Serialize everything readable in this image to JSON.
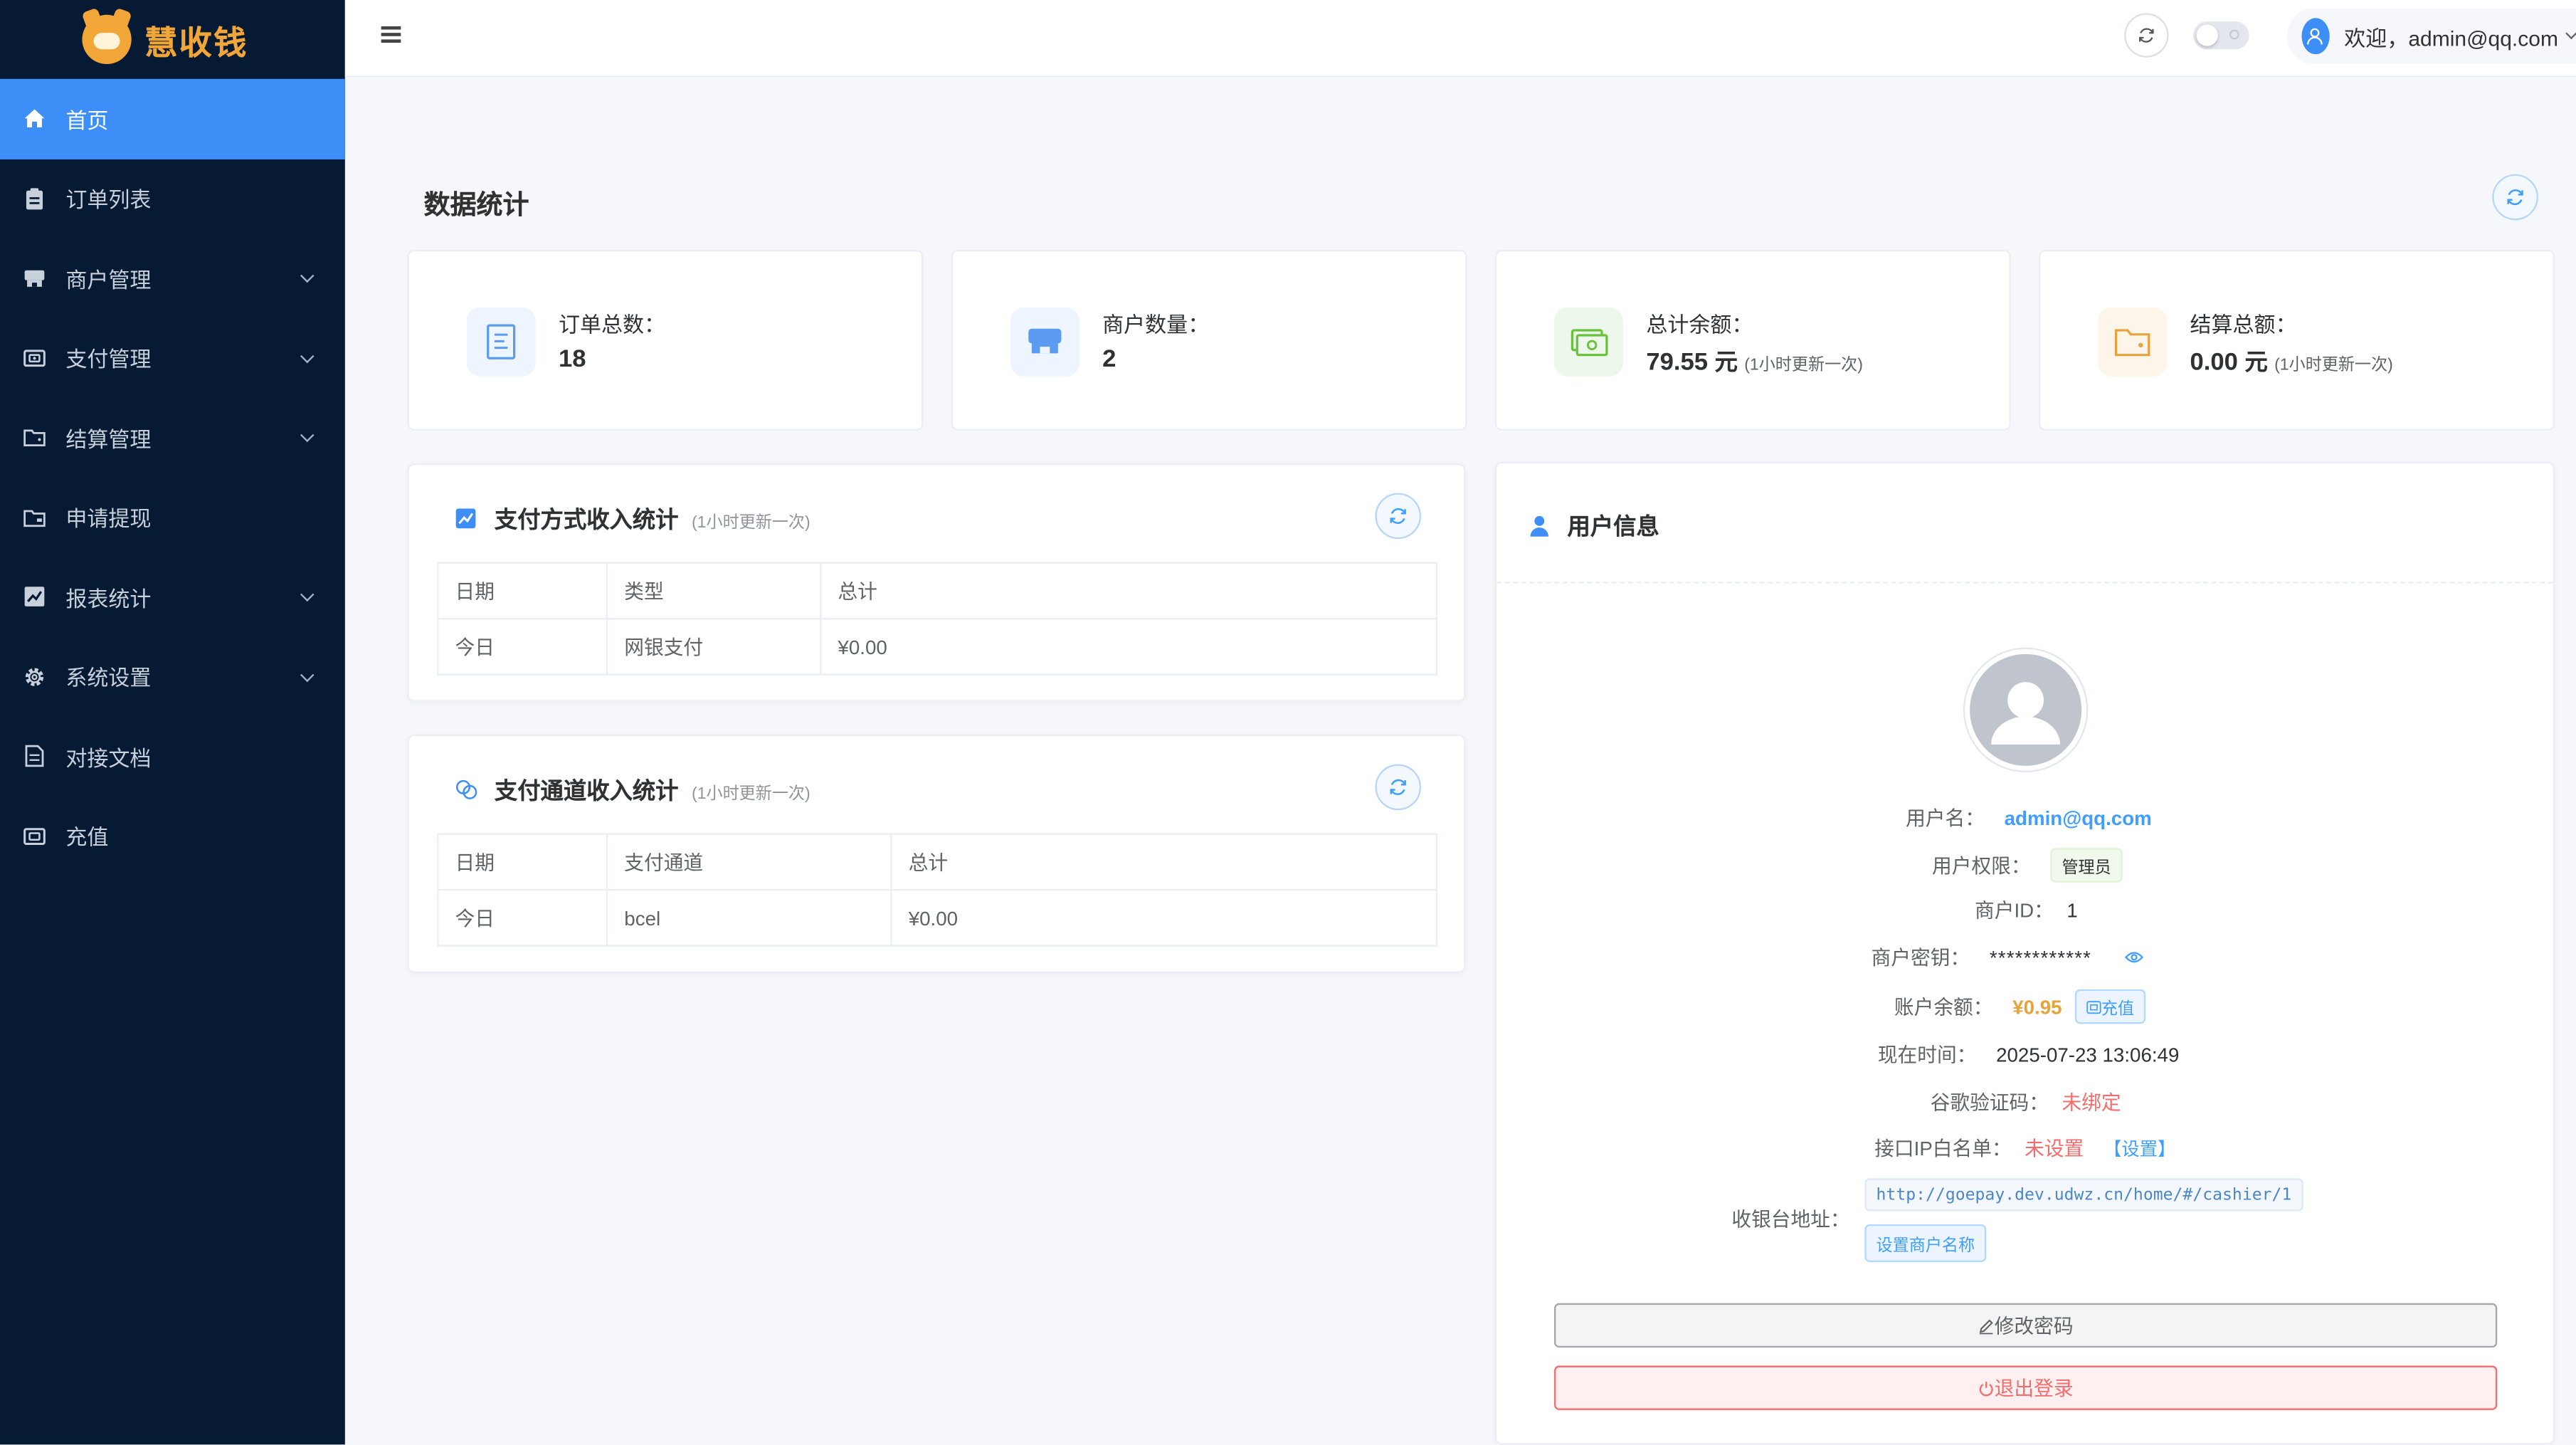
{
  "app": {
    "name": "慧收钱"
  },
  "sidebar": {
    "items": [
      {
        "label": "首页",
        "icon": "home-icon",
        "active": true
      },
      {
        "label": "订单列表",
        "icon": "clipboard-icon"
      },
      {
        "label": "商户管理",
        "icon": "shop-icon",
        "expandable": true
      },
      {
        "label": "支付管理",
        "icon": "wallet-icon",
        "expandable": true
      },
      {
        "label": "结算管理",
        "icon": "folder-icon",
        "expandable": true
      },
      {
        "label": "申请提现",
        "icon": "withdraw-icon"
      },
      {
        "label": "报表统计",
        "icon": "chart-icon",
        "expandable": true
      },
      {
        "label": "系统设置",
        "icon": "gear-icon",
        "expandable": true
      },
      {
        "label": "对接文档",
        "icon": "document-icon"
      },
      {
        "label": "充值",
        "icon": "recharge-icon"
      }
    ]
  },
  "header": {
    "welcome": "欢迎，admin@qq.com"
  },
  "page": {
    "title": "数据统计"
  },
  "stats": [
    {
      "label": "订单总数：",
      "value": "18",
      "unit": "",
      "note": ""
    },
    {
      "label": "商户数量：",
      "value": "2",
      "unit": "",
      "note": ""
    },
    {
      "label": "总计余额：",
      "value": "79.55",
      "unit": "元",
      "note": "(1小时更新一次)"
    },
    {
      "label": "结算总额：",
      "value": "0.00",
      "unit": "元",
      "note": "(1小时更新一次)"
    }
  ],
  "pay_method_panel": {
    "title": "支付方式收入统计",
    "note": "(1小时更新一次)",
    "headers": [
      "日期",
      "类型",
      "总计"
    ],
    "rows": [
      [
        "今日",
        "网银支付",
        "¥0.00"
      ]
    ]
  },
  "pay_channel_panel": {
    "title": "支付通道收入统计",
    "note": "(1小时更新一次)",
    "headers": [
      "日期",
      "支付通道",
      "总计"
    ],
    "rows": [
      [
        "今日",
        "bcel",
        "¥0.00"
      ]
    ]
  },
  "user_panel": {
    "title": "用户信息",
    "username_label": "用户名：",
    "username": "admin@qq.com",
    "role_label": "用户权限：",
    "role": "管理员",
    "merchant_id_label": "商户ID：",
    "merchant_id": "1",
    "secret_label": "商户密钥：",
    "secret": "************",
    "balance_label": "账户余额：",
    "balance": "¥0.95",
    "recharge_label": "充值",
    "time_label": "现在时间：",
    "time": "2025-07-23 13:06:49",
    "google_label": "谷歌验证码：",
    "google_status": "未绑定",
    "ip_label": "接口IP白名单：",
    "ip_status": "未设置",
    "ip_set": "【设置】",
    "cashier_label": "收银台地址：",
    "cashier_url": "http://goepay.dev.udwz.cn/home/#/cashier/1",
    "set_merchant_name": "设置商户名称",
    "change_password": "修改密码",
    "logout": "退出登录"
  },
  "colors": {
    "sidebar_bg": "#071a33",
    "accent": "#3d8ff7",
    "danger": "#f56c6c",
    "warning": "#e6a23c"
  }
}
